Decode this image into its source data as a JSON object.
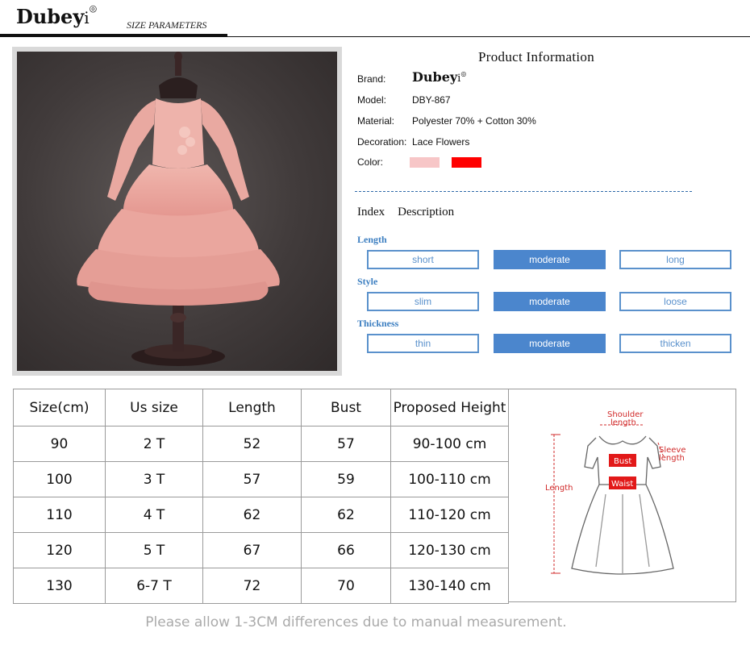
{
  "header": {
    "logo_main": "Dubey",
    "logo_tail": "i",
    "section_title": "SIZE PARAMETERS"
  },
  "product_info": {
    "title": "Product  Information",
    "rows": [
      {
        "label": "Brand:",
        "value": "Dubeyi"
      },
      {
        "label": "Model:",
        "value": "DBY-867"
      },
      {
        "label": "Material:",
        "value": "Polyester 70% + Cotton 30%"
      },
      {
        "label": "Decoration:",
        "value": "Lace Flowers"
      },
      {
        "label": "Color:",
        "value": ""
      }
    ],
    "colors": [
      "#f7c6c7",
      "#ff0000"
    ]
  },
  "index": {
    "heading": "Index",
    "description": "Description",
    "categories": [
      {
        "name": "Length",
        "options": [
          "short",
          "moderate",
          "long"
        ],
        "selected": 1
      },
      {
        "name": "Style",
        "options": [
          "slim",
          "moderate",
          "loose"
        ],
        "selected": 1
      },
      {
        "name": "Thickness",
        "options": [
          "thin",
          "moderate",
          "thicken"
        ],
        "selected": 1
      }
    ]
  },
  "size_table": {
    "headers": [
      "Size(cm)",
      "Us size",
      "Length",
      "Bust",
      "Proposed Height"
    ],
    "rows": [
      [
        "90",
        "2 T",
        "52",
        "57",
        "90-100 cm"
      ],
      [
        "100",
        "3 T",
        "57",
        "59",
        "100-110 cm"
      ],
      [
        "110",
        "4 T",
        "62",
        "62",
        "110-120 cm"
      ],
      [
        "120",
        "5 T",
        "67",
        "66",
        "120-130 cm"
      ],
      [
        "130",
        "6-7 T",
        "72",
        "70",
        "130-140 cm"
      ]
    ]
  },
  "diagram": {
    "shoulder": "Shoulder",
    "shoulder2": "length",
    "sleeve": "Sleeve",
    "sleeve2": "length",
    "bust": "Bust",
    "waist": "Waist",
    "length": "Length"
  },
  "footer": "Please allow 1-3CM differences due to manual measurement."
}
